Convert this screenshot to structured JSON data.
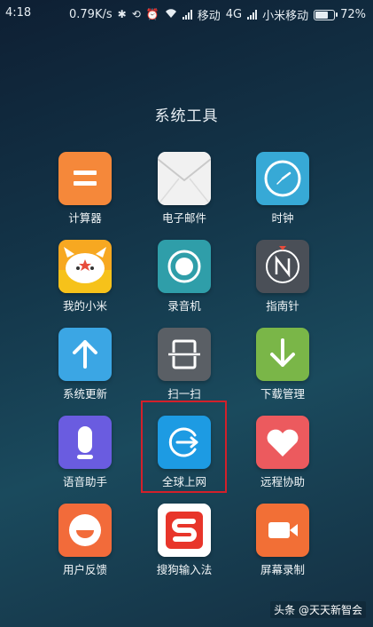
{
  "status_bar": {
    "time": "4:18",
    "speed": "0.79K/s",
    "carrier1": "移动",
    "network": "4G",
    "carrier2": "小米移动",
    "battery": "72%",
    "battery_level": 0.72
  },
  "folder": {
    "title": "系统工具"
  },
  "apps": [
    {
      "label": "计算器",
      "color": "#f5883a"
    },
    {
      "label": "电子邮件",
      "color": "#eeeeee"
    },
    {
      "label": "时钟",
      "color": "#37a9d6"
    },
    {
      "label": "我的小米",
      "color": "#f7a821"
    },
    {
      "label": "录音机",
      "color": "#2f9ea9"
    },
    {
      "label": "指南针",
      "color": "#4a4f57"
    },
    {
      "label": "系统更新",
      "color": "#3ba6e4"
    },
    {
      "label": "扫一扫",
      "color": "#5a5f65"
    },
    {
      "label": "下载管理",
      "color": "#7ab648"
    },
    {
      "label": "语音助手",
      "color": "#6a5ce0"
    },
    {
      "label": "全球上网",
      "color": "#1d9be3"
    },
    {
      "label": "远程协助",
      "color": "#ec5a5e"
    },
    {
      "label": "用户反馈",
      "color": "#f26b3a"
    },
    {
      "label": "搜狗输入法",
      "color": "#ffffff"
    },
    {
      "label": "屏幕录制",
      "color": "#f26f36"
    }
  ],
  "watermark": "头条 @天天新智会"
}
